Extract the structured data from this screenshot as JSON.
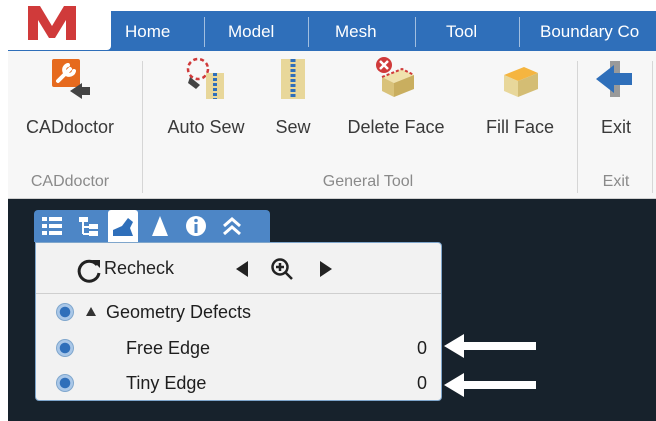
{
  "colors": {
    "menubar": "#2f6fba",
    "accent": "#2f6fba",
    "viewport": "#17222c",
    "logo_red": "#d03a3a"
  },
  "logo": {
    "icon": "app-logo-m-icon"
  },
  "menu": {
    "items": [
      {
        "label": "Home"
      },
      {
        "label": "Model"
      },
      {
        "label": "Mesh"
      },
      {
        "label": "Tool"
      },
      {
        "label": "Boundary Co"
      }
    ]
  },
  "ribbon": {
    "buttons": [
      {
        "label": "CADdoctor",
        "icon": "caddoctor-icon"
      },
      {
        "label": "Auto Sew",
        "icon": "auto-sew-icon"
      },
      {
        "label": "Sew",
        "icon": "sew-icon"
      },
      {
        "label": "Delete Face",
        "icon": "delete-face-icon"
      },
      {
        "label": "Fill Face",
        "icon": "fill-face-icon"
      },
      {
        "label": "Exit",
        "icon": "exit-arrow-icon"
      }
    ],
    "groups": [
      {
        "label": "CADdoctor"
      },
      {
        "label": "General Tool"
      },
      {
        "label": "Exit"
      }
    ]
  },
  "panel": {
    "tabs": [
      {
        "icon": "list-icon"
      },
      {
        "icon": "tree-icon"
      },
      {
        "icon": "model-icon"
      },
      {
        "icon": "mesh-icon"
      },
      {
        "icon": "info-icon"
      },
      {
        "icon": "collapse-icon"
      }
    ],
    "toolbar": {
      "recheck_label": "Recheck",
      "prev_icon": "triangle-left-icon",
      "zoom_icon": "zoom-in-icon",
      "next_icon": "triangle-right-icon"
    },
    "tree": {
      "group_label": "Geometry Defects",
      "items": [
        {
          "label": "Free Edge",
          "value": "0"
        },
        {
          "label": "Tiny Edge",
          "value": "0"
        }
      ]
    }
  }
}
